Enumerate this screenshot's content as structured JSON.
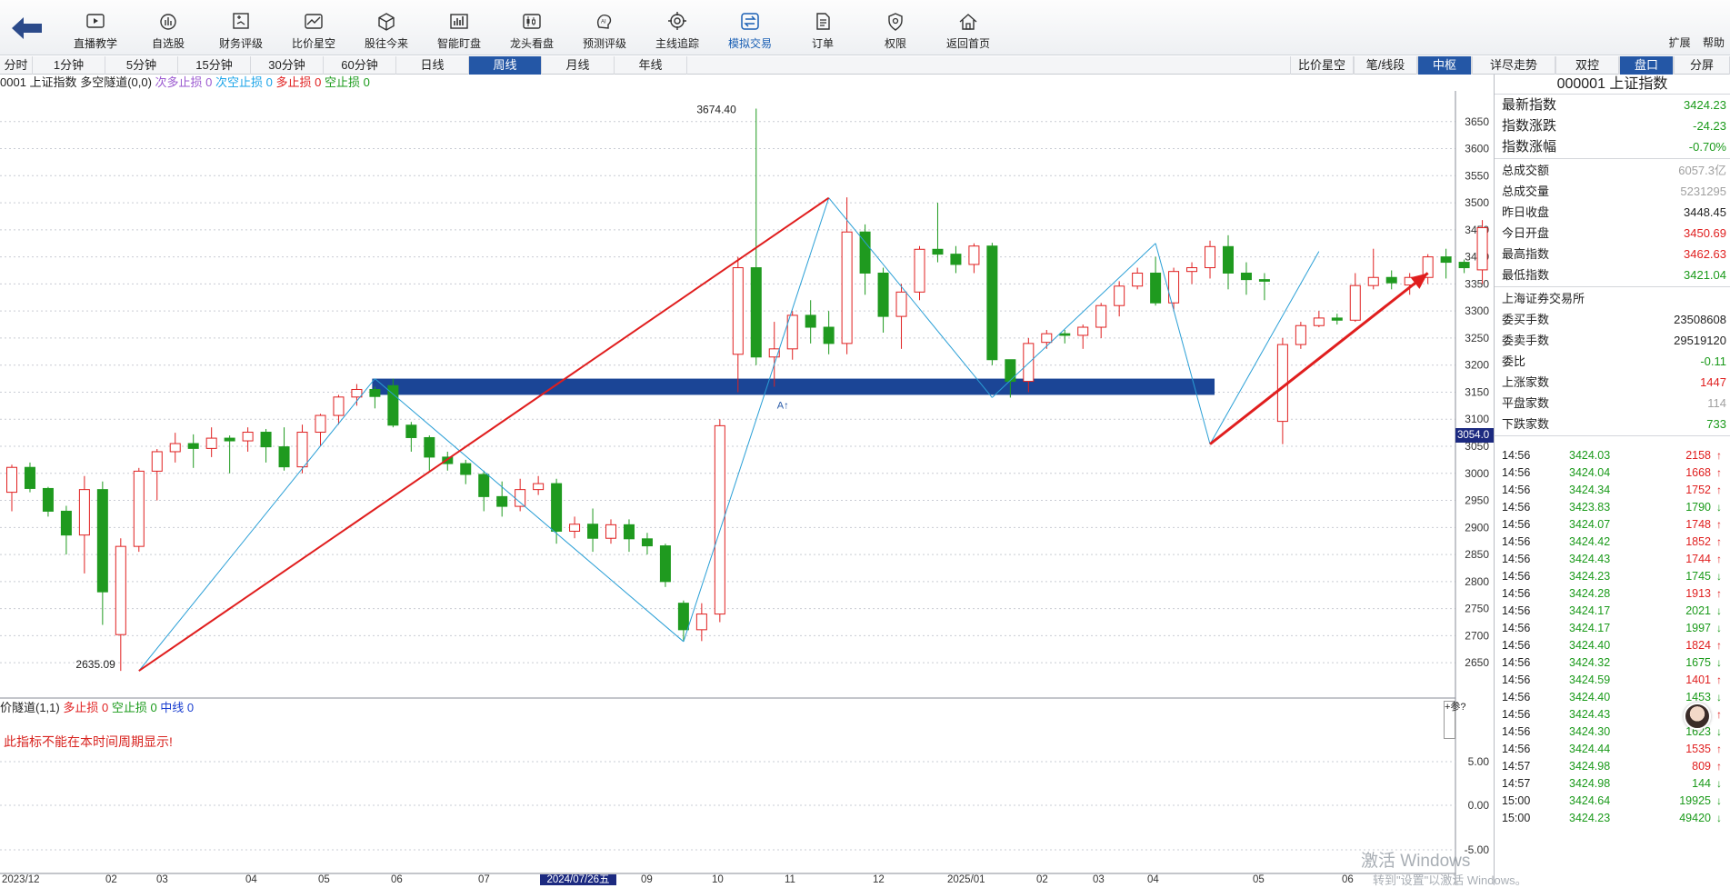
{
  "toolbar": {
    "items": [
      {
        "label": "直播教学",
        "icon": "play-icon"
      },
      {
        "label": "自选股",
        "icon": "chart-pie-icon"
      },
      {
        "label": "财务评级",
        "icon": "finance-icon"
      },
      {
        "label": "比价星空",
        "icon": "trend-icon"
      },
      {
        "label": "股往今来",
        "icon": "cube-icon"
      },
      {
        "label": "智能盯盘",
        "icon": "bar-chart-icon"
      },
      {
        "label": "龙头看盘",
        "icon": "candles-icon"
      },
      {
        "label": "预测评级",
        "icon": "ai-icon"
      },
      {
        "label": "主线追踪",
        "icon": "target-icon"
      },
      {
        "label": "模拟交易",
        "icon": "exchange-icon"
      },
      {
        "label": "订单",
        "icon": "document-icon"
      },
      {
        "label": "权限",
        "icon": "shield-icon"
      },
      {
        "label": "返回首页",
        "icon": "home-icon"
      }
    ],
    "active_index": 9,
    "right": {
      "expand": "扩展",
      "help": "帮助"
    }
  },
  "periods": {
    "left": [
      "分时",
      "1分钟",
      "5分钟",
      "15分钟",
      "30分钟",
      "60分钟",
      "日线",
      "周线",
      "月线",
      "年线"
    ],
    "active_left": 7,
    "right": [
      "比价星空",
      "笔/线段",
      "中枢",
      "详尽走势",
      "双控",
      "盘口",
      "分屏"
    ],
    "active_right": [
      2,
      5
    ]
  },
  "indicator": {
    "code_prefix": "0001",
    "name": "上证指数",
    "channel": "多空隧道(0,0)",
    "items": [
      {
        "label": "次多止损",
        "value": "0",
        "color": "#9b59d0"
      },
      {
        "label": "次空止损",
        "value": "0",
        "color": "#1aa3e8"
      },
      {
        "label": "多止损",
        "value": "0",
        "color": "#e02020"
      },
      {
        "label": "空止损",
        "value": "0",
        "color": "#1a9a1a"
      }
    ]
  },
  "sub_indicator": {
    "name": "价隧道(1,1)",
    "items": [
      {
        "label": "多止损",
        "value": "0",
        "color": "#e02020"
      },
      {
        "label": "空止损",
        "value": "0",
        "color": "#1a9a1a"
      },
      {
        "label": "中线",
        "value": "0",
        "color": "#1a3fd0"
      }
    ],
    "message": "此指标不能在本时间周期显示!",
    "side_button": "+参?",
    "y_ticks": [
      "5.00",
      "0.00",
      "-5.00"
    ]
  },
  "chart_data": {
    "type": "candlestick",
    "period": "weekly",
    "y_ticks": [
      3650,
      3600,
      3550,
      3500,
      3450,
      3400,
      3350,
      3300,
      3250,
      3200,
      3150,
      3100,
      3050,
      3000,
      2950,
      2900,
      2850,
      2800,
      2750,
      2700,
      2650
    ],
    "ylim": [
      2615,
      3700
    ],
    "annotations": {
      "high_label": "3674.40",
      "low_label": "2635.09",
      "marker": "A↑",
      "cursor_value": "3054.0"
    },
    "zhongshu_band": {
      "low": 3145,
      "high": 3175
    },
    "x_labels": [
      "2023/12",
      "02",
      "03",
      "04",
      "05",
      "06",
      "07",
      "2024/07/26五",
      "09",
      "10",
      "11",
      "12",
      "2025/01",
      "02",
      "03",
      "04",
      "05",
      "06"
    ],
    "highlighted_x_label": "2024/07/26五",
    "candles": [
      [
        2965,
        3011,
        2930,
        3016
      ],
      [
        3011,
        2972,
        2965,
        3020
      ],
      [
        2972,
        2930,
        2920,
        2975
      ],
      [
        2930,
        2886,
        2850,
        2940
      ],
      [
        2886,
        2970,
        2815,
        2995
      ],
      [
        2970,
        2781,
        2720,
        2985
      ],
      [
        2702,
        2865,
        2635,
        2880
      ],
      [
        2865,
        3004,
        2855,
        3010
      ],
      [
        3004,
        3040,
        2950,
        3045
      ],
      [
        3040,
        3055,
        3020,
        3075
      ],
      [
        3055,
        3046,
        3010,
        3072
      ],
      [
        3046,
        3065,
        3030,
        3085
      ],
      [
        3065,
        3060,
        3000,
        3070
      ],
      [
        3060,
        3076,
        3040,
        3085
      ],
      [
        3076,
        3049,
        3020,
        3082
      ],
      [
        3049,
        3012,
        3005,
        3085
      ],
      [
        3012,
        3076,
        3000,
        3090
      ],
      [
        3076,
        3107,
        3050,
        3110
      ],
      [
        3107,
        3141,
        3090,
        3145
      ],
      [
        3141,
        3155,
        3125,
        3165
      ],
      [
        3155,
        3142,
        3120,
        3160
      ],
      [
        3162,
        3089,
        3085,
        3175
      ],
      [
        3089,
        3066,
        3040,
        3095
      ],
      [
        3066,
        3030,
        3005,
        3070
      ],
      [
        3030,
        3018,
        3005,
        3040
      ],
      [
        3018,
        2998,
        2980,
        3025
      ],
      [
        2998,
        2957,
        2930,
        3005
      ],
      [
        2957,
        2939,
        2920,
        2985
      ],
      [
        2939,
        2970,
        2930,
        2990
      ],
      [
        2970,
        2981,
        2960,
        2995
      ],
      [
        2981,
        2893,
        2870,
        2990
      ],
      [
        2893,
        2906,
        2880,
        2920
      ],
      [
        2906,
        2880,
        2855,
        2935
      ],
      [
        2880,
        2905,
        2870,
        2915
      ],
      [
        2905,
        2879,
        2855,
        2915
      ],
      [
        2879,
        2866,
        2850,
        2890
      ],
      [
        2866,
        2800,
        2790,
        2870
      ],
      [
        2760,
        2711,
        2690,
        2765
      ],
      [
        2711,
        2740,
        2690,
        2760
      ],
      [
        2740,
        3088,
        2725,
        3100
      ],
      [
        3220,
        3380,
        3150,
        3400
      ],
      [
        3380,
        3215,
        3200,
        3674
      ],
      [
        3215,
        3230,
        3160,
        3280
      ],
      [
        3230,
        3292,
        3210,
        3300
      ],
      [
        3292,
        3270,
        3240,
        3320
      ],
      [
        3270,
        3240,
        3220,
        3300
      ],
      [
        3240,
        3446,
        3220,
        3510
      ],
      [
        3446,
        3370,
        3330,
        3460
      ],
      [
        3370,
        3290,
        3260,
        3380
      ],
      [
        3290,
        3335,
        3230,
        3350
      ],
      [
        3335,
        3414,
        3320,
        3420
      ],
      [
        3414,
        3405,
        3390,
        3500
      ],
      [
        3405,
        3386,
        3370,
        3420
      ],
      [
        3386,
        3420,
        3370,
        3425
      ],
      [
        3420,
        3210,
        3200,
        3426
      ],
      [
        3210,
        3170,
        3140,
        3200
      ],
      [
        3170,
        3240,
        3150,
        3250
      ],
      [
        3242,
        3258,
        3230,
        3265
      ],
      [
        3258,
        3255,
        3240,
        3265
      ],
      [
        3255,
        3270,
        3230,
        3275
      ],
      [
        3270,
        3310,
        3250,
        3315
      ],
      [
        3310,
        3346,
        3290,
        3355
      ],
      [
        3346,
        3370,
        3340,
        3380
      ],
      [
        3370,
        3315,
        3310,
        3400
      ],
      [
        3315,
        3373,
        3300,
        3380
      ],
      [
        3373,
        3380,
        3350,
        3390
      ],
      [
        3380,
        3419,
        3360,
        3430
      ],
      [
        3419,
        3370,
        3340,
        3440
      ],
      [
        3370,
        3358,
        3330,
        3390
      ],
      [
        3358,
        3355,
        3320,
        3370
      ],
      [
        3096,
        3238,
        3054,
        3250
      ],
      [
        3238,
        3273,
        3230,
        3280
      ],
      [
        3273,
        3287,
        3270,
        3300
      ],
      [
        3287,
        3283,
        3275,
        3295
      ],
      [
        3283,
        3347,
        3280,
        3370
      ],
      [
        3347,
        3362,
        3340,
        3415
      ],
      [
        3362,
        3352,
        3340,
        3375
      ],
      [
        3348,
        3362,
        3330,
        3370
      ],
      [
        3362,
        3400,
        3350,
        3405
      ],
      [
        3400,
        3390,
        3360,
        3415
      ],
      [
        3390,
        3380,
        3370,
        3395
      ],
      [
        3376,
        3454,
        3350,
        3468
      ]
    ],
    "bi_lines": [
      {
        "from": [
          7,
          2635
        ],
        "to": [
          20,
          3175
        ]
      },
      {
        "from": [
          20,
          3175
        ],
        "to": [
          37,
          2689
        ]
      },
      {
        "from": [
          37,
          2689
        ],
        "to": [
          45,
          3509
        ]
      },
      {
        "from": [
          45,
          3509
        ],
        "to": [
          54,
          3140
        ]
      },
      {
        "from": [
          54,
          3140
        ],
        "to": [
          63,
          3425
        ]
      },
      {
        "from": [
          63,
          3425
        ],
        "to": [
          66,
          3054
        ]
      },
      {
        "from": [
          66,
          3054
        ],
        "to": [
          72,
          3410
        ]
      }
    ],
    "segment_lines": [
      {
        "from": [
          7,
          2635
        ],
        "to": [
          45,
          3509
        ]
      },
      {
        "from": [
          66,
          3054
        ],
        "to": [
          78,
          3370
        ]
      }
    ]
  },
  "quote_panel": {
    "title": "000001  上证指数",
    "main_rows": [
      {
        "label": "最新指数",
        "value": "3424.23",
        "color": "green"
      },
      {
        "label": "指数涨跌",
        "value": "-24.23",
        "color": "green"
      },
      {
        "label": "指数涨幅",
        "value": "-0.70%",
        "color": "green"
      }
    ],
    "rows": [
      {
        "label": "总成交额",
        "value": "6057.3亿",
        "color": "gray"
      },
      {
        "label": "总成交量",
        "value": "5231295",
        "color": "gray"
      },
      {
        "label": "昨日收盘",
        "value": "3448.45",
        "color": "black"
      },
      {
        "label": "今日开盘",
        "value": "3450.69",
        "color": "red"
      },
      {
        "label": "最高指数",
        "value": "3462.63",
        "color": "red"
      },
      {
        "label": "最低指数",
        "value": "3421.04",
        "color": "green"
      }
    ],
    "exchange": "上海证券交易所",
    "rows2": [
      {
        "label": "委买手数",
        "value": "23508608",
        "color": "black"
      },
      {
        "label": "委卖手数",
        "value": "29519120",
        "color": "black"
      },
      {
        "label": "委比",
        "value": "-0.11",
        "color": "green"
      },
      {
        "label": "上涨家数",
        "value": "1447",
        "color": "red"
      },
      {
        "label": "平盘家数",
        "value": "114",
        "color": "gray"
      },
      {
        "label": "下跌家数",
        "value": "733",
        "color": "green"
      }
    ],
    "ticks": [
      {
        "time": "14:56",
        "price": "3424.03",
        "vol": "2158",
        "dir": "up"
      },
      {
        "time": "14:56",
        "price": "3424.04",
        "vol": "1668",
        "dir": "up"
      },
      {
        "time": "14:56",
        "price": "3424.34",
        "vol": "1752",
        "dir": "up"
      },
      {
        "time": "14:56",
        "price": "3423.83",
        "vol": "1790",
        "dir": "down"
      },
      {
        "time": "14:56",
        "price": "3424.07",
        "vol": "1748",
        "dir": "up"
      },
      {
        "time": "14:56",
        "price": "3424.42",
        "vol": "1852",
        "dir": "up"
      },
      {
        "time": "14:56",
        "price": "3424.43",
        "vol": "1744",
        "dir": "up"
      },
      {
        "time": "14:56",
        "price": "3424.23",
        "vol": "1745",
        "dir": "down"
      },
      {
        "time": "14:56",
        "price": "3424.28",
        "vol": "1913",
        "dir": "up"
      },
      {
        "time": "14:56",
        "price": "3424.17",
        "vol": "2021",
        "dir": "down"
      },
      {
        "time": "14:56",
        "price": "3424.17",
        "vol": "1997",
        "dir": "down"
      },
      {
        "time": "14:56",
        "price": "3424.40",
        "vol": "1824",
        "dir": "up"
      },
      {
        "time": "14:56",
        "price": "3424.32",
        "vol": "1675",
        "dir": "down"
      },
      {
        "time": "14:56",
        "price": "3424.59",
        "vol": "1401",
        "dir": "up"
      },
      {
        "time": "14:56",
        "price": "3424.40",
        "vol": "1453",
        "dir": "down"
      },
      {
        "time": "14:56",
        "price": "3424.43",
        "vol": "1573",
        "dir": "up"
      },
      {
        "time": "14:56",
        "price": "3424.30",
        "vol": "1623",
        "dir": "down"
      },
      {
        "time": "14:56",
        "price": "3424.44",
        "vol": "1535",
        "dir": "up"
      },
      {
        "time": "14:57",
        "price": "3424.98",
        "vol": "809",
        "dir": "up"
      },
      {
        "time": "14:57",
        "price": "3424.98",
        "vol": "144",
        "dir": "down"
      },
      {
        "time": "15:00",
        "price": "3424.64",
        "vol": "19925",
        "dir": "down"
      },
      {
        "time": "15:00",
        "price": "3424.23",
        "vol": "49420",
        "dir": "down"
      }
    ]
  },
  "watermark": {
    "line1": "激活 Windows",
    "line2": "转到\"设置\"以激活 Windows。"
  },
  "colors": {
    "up": "#e02020",
    "down": "#1f9a1f",
    "band": "#1b4596",
    "bi": "#2a9fd6",
    "segment": "#e01e1e",
    "accent": "#2457a6"
  }
}
